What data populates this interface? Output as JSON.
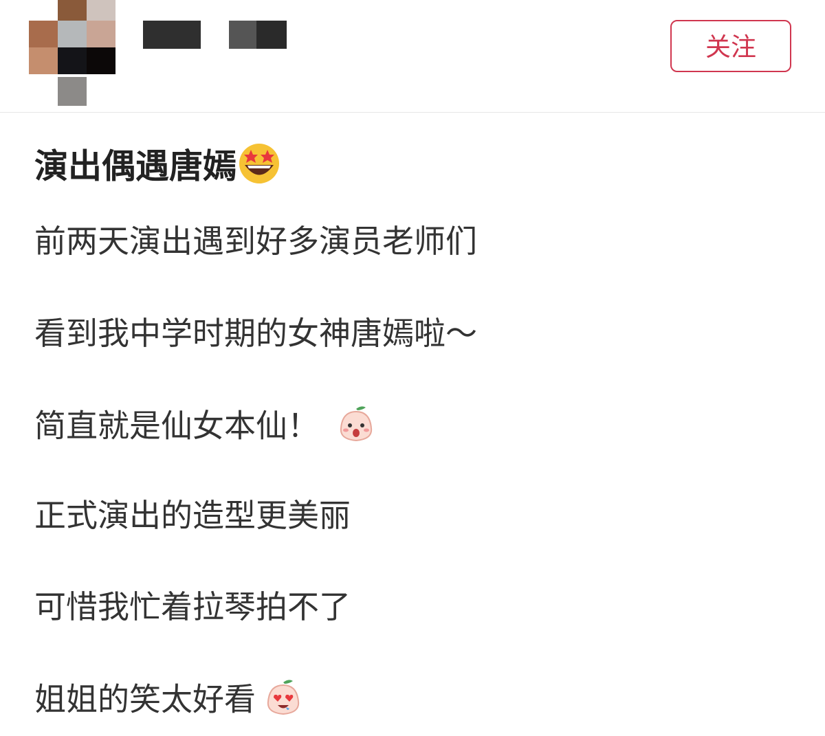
{
  "header": {
    "follow_label": "关注"
  },
  "post": {
    "title": "演出偶遇唐嫣",
    "title_emoji": "star-struck-emoji",
    "lines": [
      "前两天演出遇到好多演员老师们",
      "看到我中学时期的女神唐嫣啦～",
      "简直就是仙女本仙！",
      "正式演出的造型更美丽",
      "可惜我忙着拉琴拍不了",
      "姐姐的笑太好看"
    ],
    "line3_sticker": "surprised-sprout-sticker",
    "line6_sticker": "heart-eyes-sprout-sticker"
  },
  "colors": {
    "accent": "#d0364f",
    "text": "#333333",
    "title": "#222222"
  }
}
